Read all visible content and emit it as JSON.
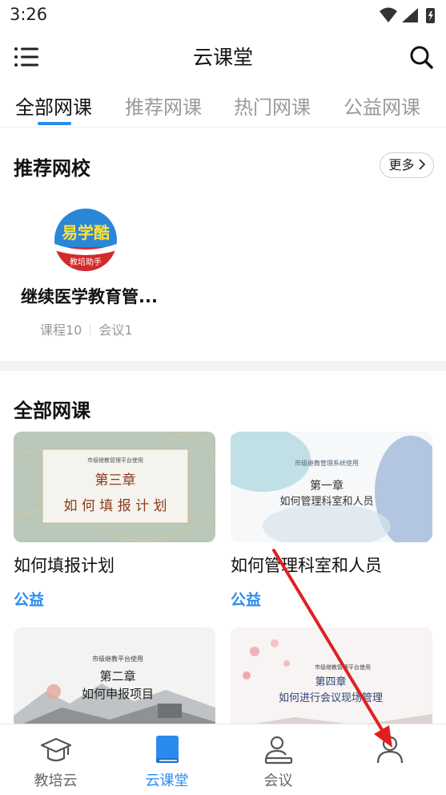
{
  "status_bar": {
    "time": "3:26",
    "icons": [
      "wifi-icon",
      "signal-icon",
      "battery-icon"
    ]
  },
  "app_bar": {
    "title": "云课堂",
    "left_icon": "menu-icon",
    "right_icon": "search-icon"
  },
  "tabs": [
    {
      "label": "全部网课",
      "active": true
    },
    {
      "label": "推荐网课",
      "active": false
    },
    {
      "label": "热门网课",
      "active": false
    },
    {
      "label": "公益网课",
      "active": false
    }
  ],
  "recommended": {
    "title": "推荐网校",
    "more_label": "更多",
    "school": {
      "logo_text": "易学酷",
      "logo_subtext": "教培助手",
      "name": "继续医学教育管...",
      "courses": "课程10",
      "meetings": "会议1"
    }
  },
  "all_courses": {
    "title": "全部网课",
    "cards": [
      {
        "thumb_caption": "市级继教管理平台使用",
        "thumb_chapter": "第三章",
        "thumb_subtitle": "如 何 填 报 计 划",
        "title": "如何填报计划",
        "tag": "公益"
      },
      {
        "thumb_caption": "市级继教管理系统使用",
        "thumb_chapter": "第一章",
        "thumb_subtitle": "如何管理科室和人员",
        "title": "如何管理科室和人员",
        "tag": "公益"
      },
      {
        "thumb_caption": "市级继教平台使用",
        "thumb_chapter": "第二章",
        "thumb_subtitle": "如何申报项目",
        "title": "",
        "tag": ""
      },
      {
        "thumb_caption": "市级继教管理平台使用",
        "thumb_chapter": "第四章",
        "thumb_subtitle": "如何进行会议现场管理",
        "title": "",
        "tag": ""
      }
    ]
  },
  "bottom_nav": [
    {
      "label": "教培云",
      "icon": "graduation-cap-icon",
      "active": false
    },
    {
      "label": "云课堂",
      "icon": "book-icon",
      "active": true
    },
    {
      "label": "会议",
      "icon": "meeting-icon",
      "active": false
    },
    {
      "label": "",
      "icon": "profile-icon",
      "active": false
    }
  ],
  "colors": {
    "accent": "#2a8bef",
    "annotation_arrow": "#e02020"
  }
}
